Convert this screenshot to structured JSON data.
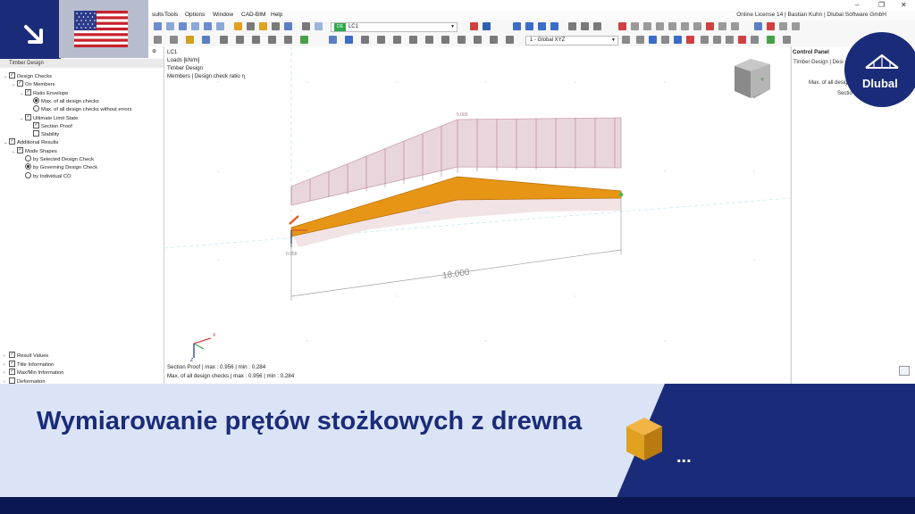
{
  "menu": {
    "items": [
      "sults",
      "Tools",
      "Options",
      "Window",
      "CAD-BIM",
      "Help"
    ],
    "license_text": "Online License 14 | Bastian Kuhn | Dlubal Software GmbH"
  },
  "toolbar": {
    "load_case_tag": "DE",
    "load_case_name": "LC1",
    "view_combo": "1 - Global XYZ"
  },
  "navigator": {
    "title": "Timber Design",
    "items": [
      {
        "label": "Design Checks",
        "level": 0,
        "kind": "check",
        "checked": true,
        "expanded": true
      },
      {
        "label": "On Members",
        "level": 1,
        "kind": "check",
        "checked": true,
        "expanded": true
      },
      {
        "label": "Ratio Envelope",
        "level": 2,
        "kind": "check",
        "checked": true,
        "expanded": true
      },
      {
        "label": "Max. of all design checks",
        "level": 3,
        "kind": "radio",
        "checked": true
      },
      {
        "label": "Max. of all design checks without errors",
        "level": 3,
        "kind": "radio",
        "checked": false
      },
      {
        "label": "Ultimate Limit State",
        "level": 2,
        "kind": "check",
        "checked": true,
        "expanded": true
      },
      {
        "label": "Section Proof",
        "level": 3,
        "kind": "check",
        "checked": true
      },
      {
        "label": "Stability",
        "level": 3,
        "kind": "check",
        "checked": false
      },
      {
        "label": "Additional Results",
        "level": 0,
        "kind": "check",
        "checked": true,
        "expanded": true
      },
      {
        "label": "Mode Shapes",
        "level": 1,
        "kind": "check",
        "checked": true,
        "expanded": true
      },
      {
        "label": "by Selected Design Check",
        "level": 2,
        "kind": "radio",
        "checked": false
      },
      {
        "label": "by Governing Design Check",
        "level": 2,
        "kind": "radio",
        "checked": true
      },
      {
        "label": "by Individual CO",
        "level": 2,
        "kind": "radio",
        "checked": false
      }
    ],
    "bottom_items": [
      {
        "label": "Result Values",
        "checked": true
      },
      {
        "label": "Title Information",
        "checked": true
      },
      {
        "label": "Max/Min Information",
        "checked": true
      },
      {
        "label": "Deformation",
        "checked": false
      }
    ]
  },
  "viewport": {
    "info_lines": [
      "LC1",
      "Loads [kN/m]",
      "Timber Design",
      "Members | Design check ratio η"
    ],
    "load_label": "5.000",
    "ratio_mid": "0.284",
    "ratio_left": "0.956",
    "dimension": "18.000",
    "axis_x": "X",
    "axis_z": "Z",
    "cube_label": "-Y",
    "summary": [
      "Section Proof | max  : 0.956 | min  : 0.284",
      "Max. of all design checks | max  : 0.956 | min  : 0.284"
    ]
  },
  "control_panel": {
    "title": "Control Panel",
    "line1": "Timber Design | Desi",
    "line2": "Max. of all desig",
    "line3": "Sectio"
  },
  "brand": {
    "name": "Dlubal"
  },
  "banner": {
    "title": "Wymiarowanie prętów stożkowych z drewna",
    "more": "..."
  },
  "colors": {
    "brand_blue": "#1a2c79",
    "banner_light": "#dbe4f7",
    "member_orange": "#e69515",
    "load_pink": "#c8a0ad"
  }
}
